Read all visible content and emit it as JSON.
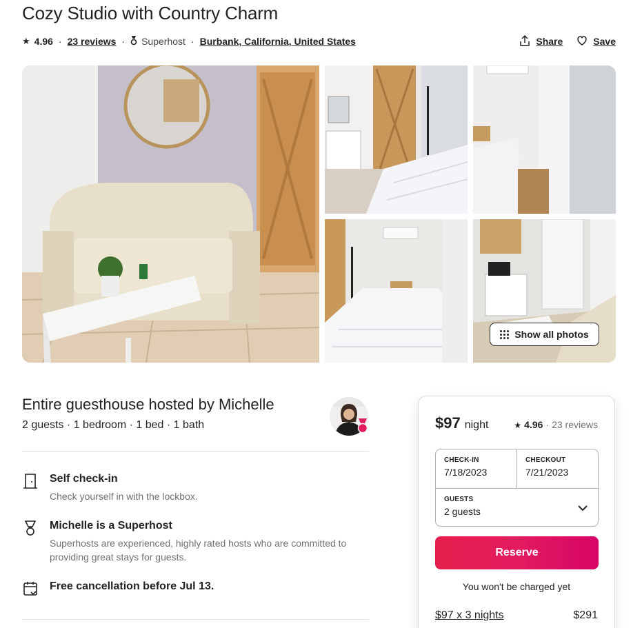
{
  "listing": {
    "title": "Cozy Studio with Country Charm",
    "rating": "4.96",
    "reviews_link": "23 reviews",
    "superhost_label": "Superhost",
    "location": "Burbank, California, United States",
    "share_label": "Share",
    "save_label": "Save"
  },
  "gallery": {
    "show_all_label": "Show all photos"
  },
  "host": {
    "title": "Entire guesthouse hosted by Michelle",
    "summary": "2 guests · 1 bedroom · 1 bed · 1 bath"
  },
  "features": [
    {
      "title": "Self check-in",
      "desc": "Check yourself in with the lockbox.",
      "icon": "door-icon"
    },
    {
      "title": "Michelle is a Superhost",
      "desc": "Superhosts are experienced, highly rated hosts who are committed to providing great stays for guests.",
      "icon": "superhost-medal-icon"
    },
    {
      "title": "Free cancellation before Jul 13.",
      "desc": "",
      "icon": "calendar-icon"
    }
  ],
  "booking": {
    "price": "$97",
    "per_night": "night",
    "rating": "4.96",
    "reviews": "23 reviews",
    "checkin_label": "CHECK-IN",
    "checkin_value": "7/18/2023",
    "checkout_label": "CHECKOUT",
    "checkout_value": "7/21/2023",
    "guests_label": "GUESTS",
    "guests_value": "2 guests",
    "reserve_label": "Reserve",
    "no_charge": "You won't be charged yet",
    "breakdown_label": "$97 x 3 nights",
    "breakdown_value": "$291"
  },
  "colors": {
    "brand": "#e31c5f",
    "text": "#222222",
    "muted": "#717171",
    "divider": "#dddddd"
  }
}
